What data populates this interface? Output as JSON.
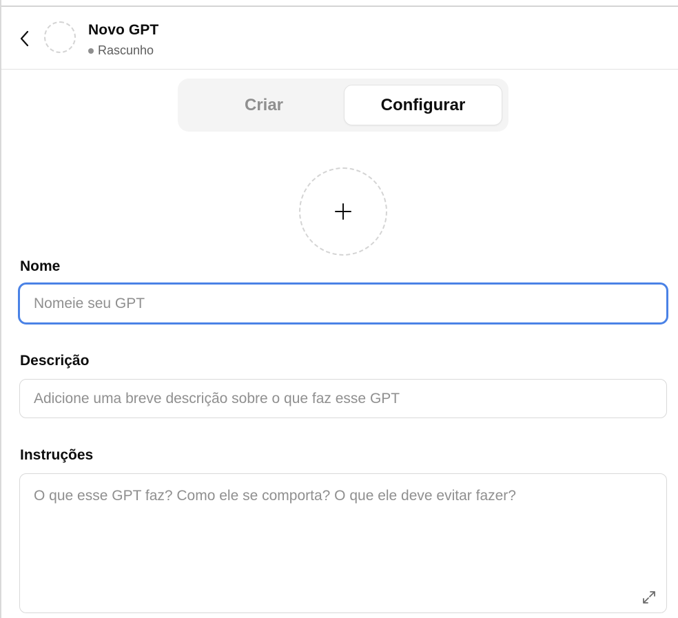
{
  "header": {
    "title": "Novo GPT",
    "status": "Rascunho"
  },
  "tabs": [
    {
      "label": "Criar",
      "active": false
    },
    {
      "label": "Configurar",
      "active": true
    }
  ],
  "form": {
    "name": {
      "label": "Nome",
      "value": "",
      "placeholder": "Nomeie seu GPT"
    },
    "description": {
      "label": "Descrição",
      "value": "",
      "placeholder": "Adicione uma breve descrição sobre o que faz esse GPT"
    },
    "instructions": {
      "label": "Instruções",
      "value": "",
      "placeholder": "O que esse GPT faz? Como ele se comporta? O que ele deve evitar fazer?"
    }
  },
  "icons": {
    "back": "chevron-left-icon",
    "add": "plus-icon",
    "expand": "expand-icon"
  },
  "colors": {
    "focus_border": "#4a82e6",
    "placeholder": "#8f8f8f",
    "tab_bg": "#f4f4f4"
  }
}
